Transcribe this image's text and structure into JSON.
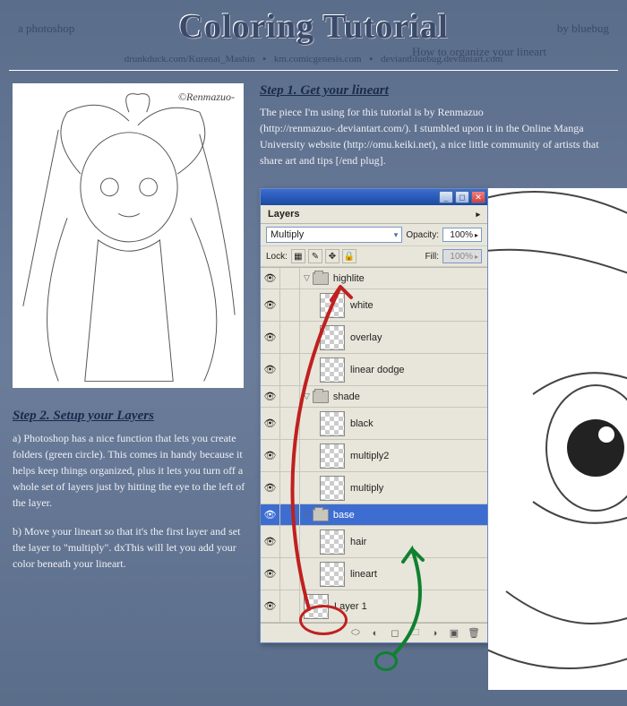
{
  "header": {
    "prefix": "a photoshop",
    "title": "Coloring Tutorial",
    "byline": "by bluebug",
    "subtitle": "How to organize your lineart"
  },
  "links": {
    "a": "drunkduck.com/Kurenai_Mashin",
    "b": "km.comicgenesis.com",
    "c": "deviantbluebug.deviantart.com"
  },
  "thumb_signature": "©Renmazuo-",
  "step1": {
    "heading": "Step 1. Get your lineart",
    "body": "The piece I'm using for this tutorial is by Renmazuo (http://renmazuo-.deviantart.com/). I stumbled upon it in the Online Manga University website (http://omu.keiki.net), a nice little community of artists that share art and tips [/end plug]."
  },
  "step2": {
    "heading": "Step 2. Setup your Layers",
    "para_a": "a) Photoshop has a nice function that lets you create folders (green circle). This comes in handy because it helps keep things organized, plus it lets you turn off a whole set of layers just by hitting the eye to the left of the layer.",
    "para_b": "b) Move your lineart so that it's the first layer and set the layer to \"multiply\". dxThis will let you add your color beneath your lineart."
  },
  "panel": {
    "tab": "Layers",
    "blend_mode": "Multiply",
    "opacity_label": "Opacity:",
    "opacity_value": "100%",
    "lock_label": "Lock:",
    "fill_label": "Fill:",
    "fill_value": "100%",
    "layers": [
      {
        "type": "folder",
        "name": "highlite",
        "indent": 0,
        "open": true
      },
      {
        "type": "layer",
        "name": "white",
        "indent": 1
      },
      {
        "type": "layer",
        "name": "overlay",
        "indent": 1
      },
      {
        "type": "layer",
        "name": "linear dodge",
        "indent": 1
      },
      {
        "type": "folder",
        "name": "shade",
        "indent": 0,
        "open": true
      },
      {
        "type": "layer",
        "name": "black",
        "indent": 1
      },
      {
        "type": "layer",
        "name": "multiply2",
        "indent": 1
      },
      {
        "type": "layer",
        "name": "multiply",
        "indent": 1
      },
      {
        "type": "folder",
        "name": "base",
        "indent": 0,
        "open": true,
        "selected": true
      },
      {
        "type": "layer",
        "name": "hair",
        "indent": 1
      },
      {
        "type": "layer",
        "name": "lineart",
        "indent": 1
      },
      {
        "type": "layer",
        "name": "Layer 1",
        "indent": 0
      }
    ]
  }
}
